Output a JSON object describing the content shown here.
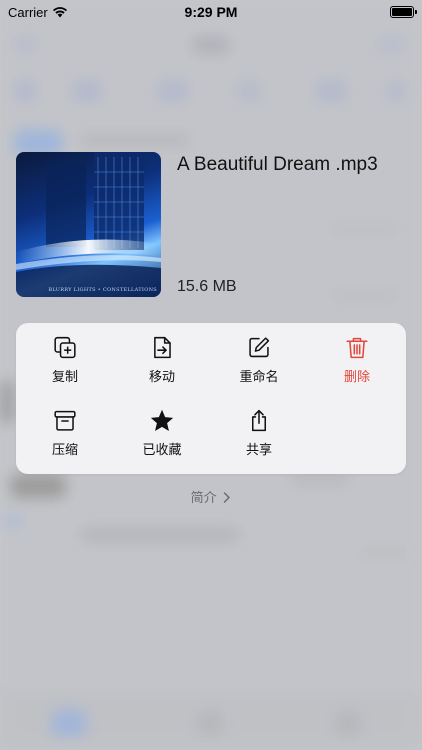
{
  "status_bar": {
    "carrier": "Carrier",
    "time": "9:29 PM",
    "battery_level": 100
  },
  "file": {
    "name": "A Beautiful Dream .mp3",
    "size": "15.6 MB",
    "cover_caption": "BLURRY LIGHTS • CONSTELLATIONS"
  },
  "actions": [
    {
      "label": "复制",
      "icon": "copy-icon",
      "color": "#111111"
    },
    {
      "label": "移动",
      "icon": "move-icon",
      "color": "#111111"
    },
    {
      "label": "重命名",
      "icon": "rename-icon",
      "color": "#111111"
    },
    {
      "label": "删除",
      "icon": "trash-icon",
      "color": "#e5453a"
    },
    {
      "label": "压缩",
      "icon": "archive-icon",
      "color": "#111111"
    },
    {
      "label": "已收藏",
      "icon": "star-icon",
      "color": "#111111"
    },
    {
      "label": "共享",
      "icon": "share-icon",
      "color": "#111111"
    }
  ],
  "info": {
    "label": "简介",
    "icon": "chevron-right-icon"
  }
}
